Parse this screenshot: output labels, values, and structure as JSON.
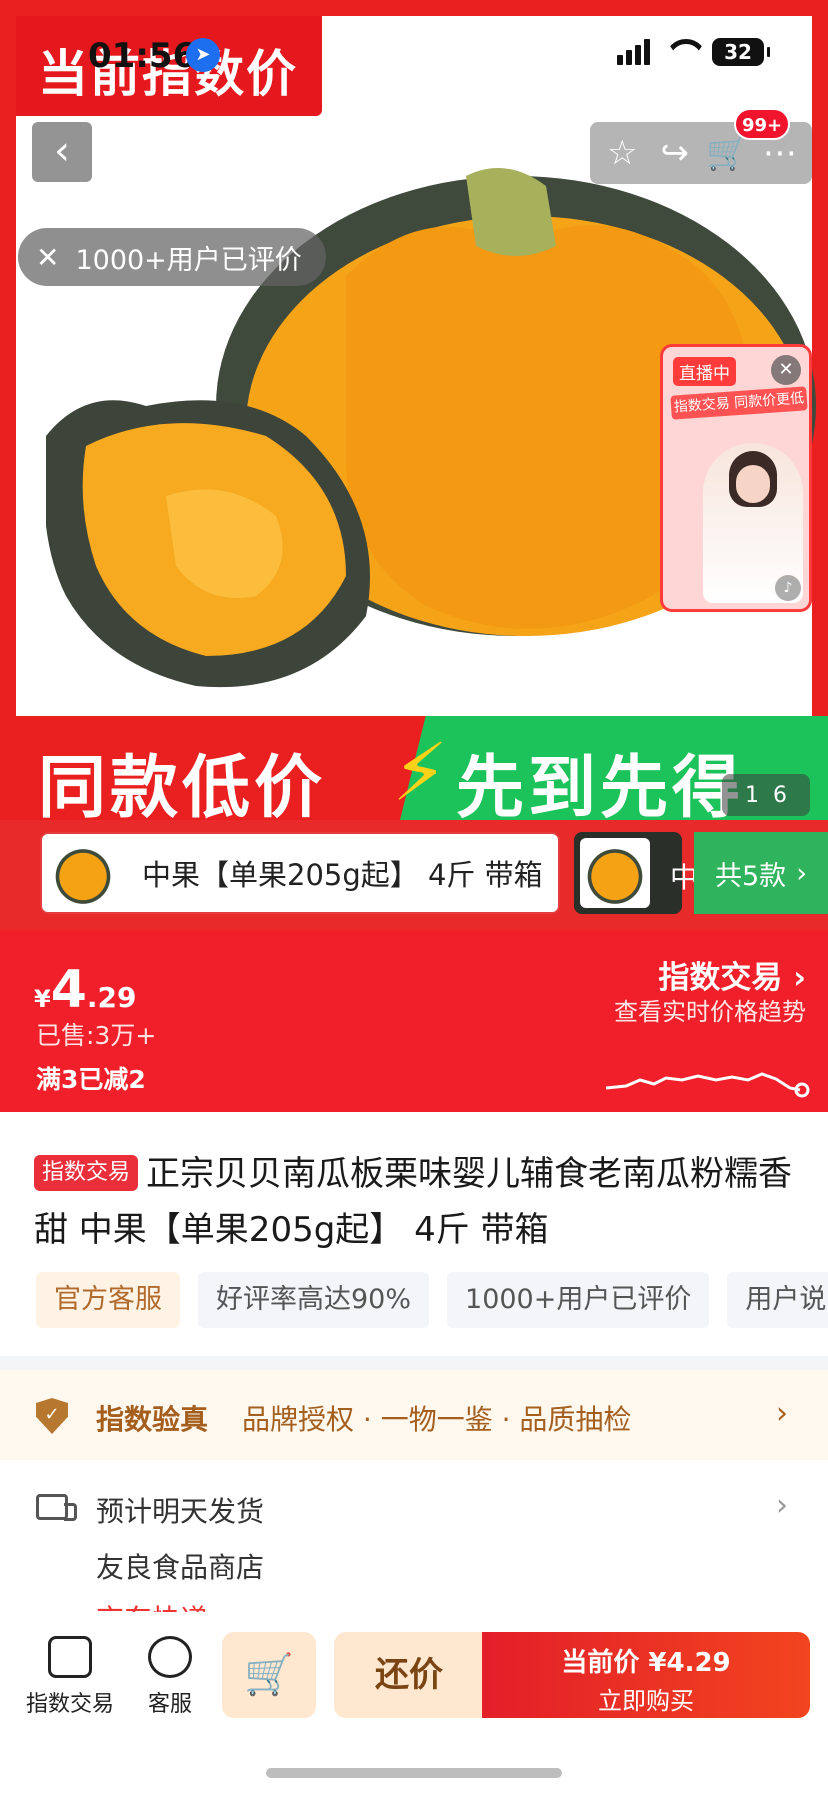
{
  "status_bar": {
    "time": "01:56",
    "battery": "32"
  },
  "hero": {
    "top_banner": "当前指数价",
    "review_pill": "1000+用户已评价",
    "cart_badge": "99+",
    "live": {
      "tag": "直播中",
      "poster": "指数交易 同款价更低"
    },
    "bottom_left": "同款低价",
    "bottom_right": "先到先得",
    "page_current": "1",
    "page_total": "6"
  },
  "variants": {
    "selected": "中果【单果205g起】 4斤 带箱",
    "second_partial": "中",
    "count_label": "共5款"
  },
  "price": {
    "yen": "¥",
    "integer": "4",
    "decimal": ".29",
    "sold": "已售:3万+",
    "promo": "满3已减2",
    "index_trade": "指数交易",
    "index_sub": "查看实时价格趋势"
  },
  "product": {
    "tag": "指数交易",
    "title": "正宗贝贝南瓜板栗味婴儿辅食老南瓜粉糯香甜 中果【单果205g起】 4斤 带箱",
    "chips": [
      "官方客服",
      "好评率高达90%",
      "1000+用户已评价",
      "用户说"
    ]
  },
  "verify": {
    "title": "指数验真",
    "desc": "品牌授权 · 一物一鉴 · 品质抽检"
  },
  "shipping": {
    "line1": "预计明天发货",
    "line2": "友良食品商店",
    "line3": "京东快递"
  },
  "bottom_bar": {
    "index_trade": "指数交易",
    "service": "客服",
    "bargain": "还价",
    "buy_line1": "当前价 ¥4.29",
    "buy_line2": "立即购买"
  }
}
